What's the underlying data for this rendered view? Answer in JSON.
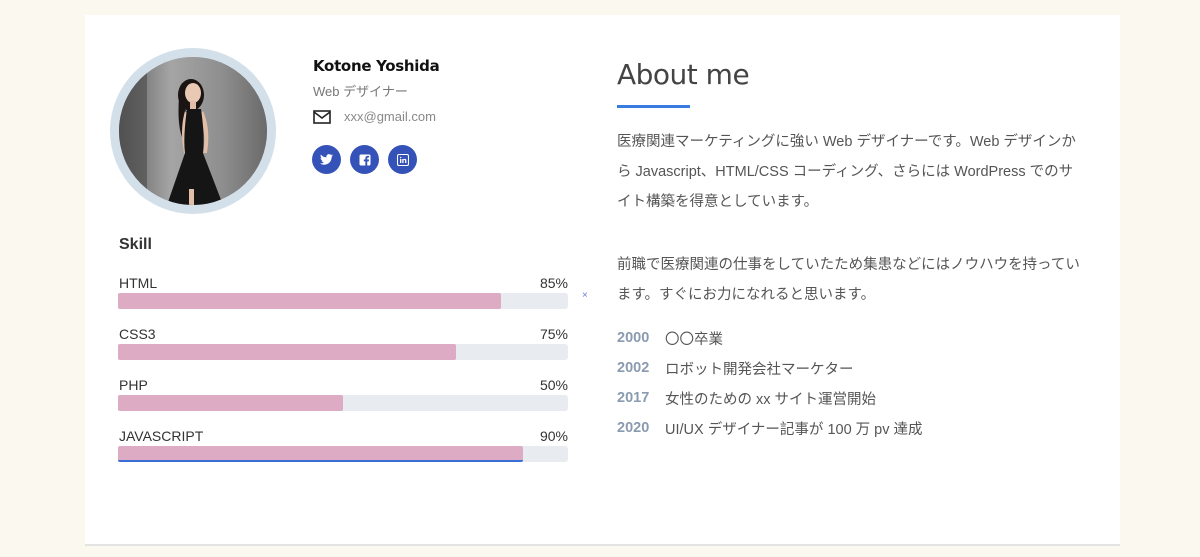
{
  "profile": {
    "name": "Kotone Yoshida",
    "role": "Web デザイナー",
    "email": "xxx@gmail.com",
    "socials": [
      {
        "icon": "twitter-icon",
        "label": "Twitter"
      },
      {
        "icon": "facebook-icon",
        "label": "Facebook"
      },
      {
        "icon": "linkedin-icon",
        "label": "LinkedIn"
      }
    ]
  },
  "skills": {
    "title": "Skill",
    "items": [
      {
        "label": "HTML",
        "percent_text": "85%",
        "value": 85
      },
      {
        "label": "CSS3",
        "percent_text": "75%",
        "value": 75
      },
      {
        "label": "PHP",
        "percent_text": "50%",
        "value": 50
      },
      {
        "label": "JAVASCRIPT",
        "percent_text": "90%",
        "value": 90
      }
    ],
    "marker": "×"
  },
  "about": {
    "title": "About me",
    "paragraph1": "医療関連マーケティングに強い Web デザイナーです。Web デザインから Javascript、HTML/CSS コーディング、さらには WordPress でのサイト構築を得意としています。",
    "paragraph2": "前職で医療関連の仕事をしていたため集患などにはノウハウを持っています。すぐにお力になれると思います。",
    "timeline": [
      {
        "year": "2000",
        "text": "〇〇卒業"
      },
      {
        "year": "2002",
        "text": "ロボット開発会社マーケター"
      },
      {
        "year": "2017",
        "text": "女性のための xx サイト運営開始"
      },
      {
        "year": "2020",
        "text": "UI/UX デザイナー記事が 100 万 pv 達成"
      }
    ]
  },
  "colors": {
    "background": "#fbf8ef",
    "bar_fill": "#ddabc4",
    "bar_track": "#e8ebef",
    "social": "#3552b8",
    "accent": "#3a7be0"
  }
}
